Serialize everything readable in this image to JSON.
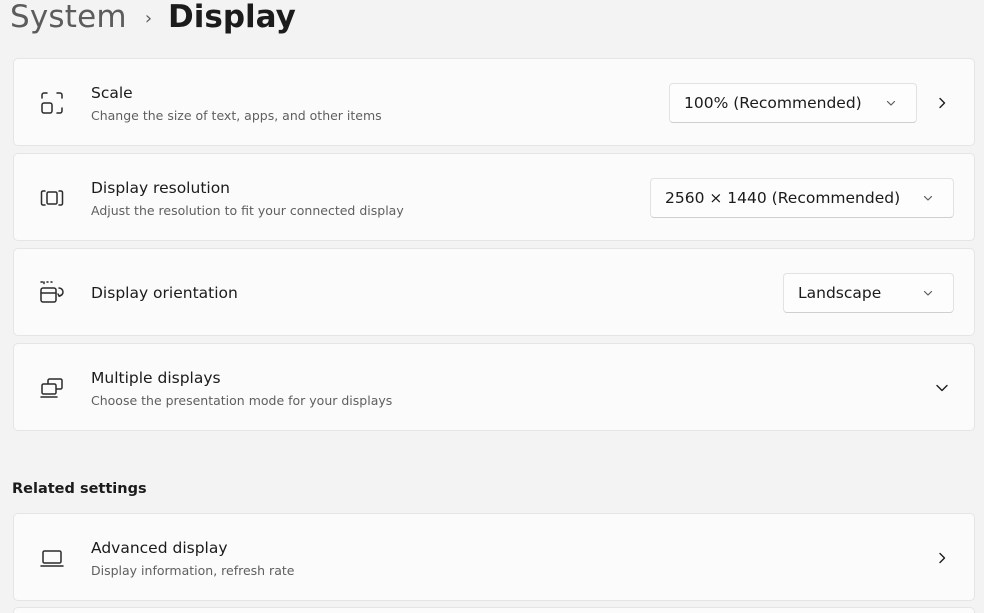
{
  "breadcrumb": {
    "parent": "System",
    "separator": "›",
    "current": "Display"
  },
  "scale": {
    "title": "Scale",
    "subtitle": "Change the size of text, apps, and other items",
    "value": "100% (Recommended)",
    "icon": "scale-icon"
  },
  "resolution": {
    "title": "Display resolution",
    "subtitle": "Adjust the resolution to fit your connected display",
    "value": "2560 × 1440 (Recommended)",
    "icon": "resolution-icon"
  },
  "orientation": {
    "title": "Display orientation",
    "value": "Landscape",
    "icon": "orientation-icon"
  },
  "multiple_displays": {
    "title": "Multiple displays",
    "subtitle": "Choose the presentation mode for your displays",
    "icon": "multiple-displays-icon"
  },
  "related": {
    "heading": "Related settings",
    "advanced": {
      "title": "Advanced display",
      "subtitle": "Display information, refresh rate",
      "icon": "laptop-icon"
    }
  },
  "colors": {
    "background": "#f3f3f3",
    "card": "#fbfbfb",
    "text": "#1b1b1b",
    "subtext": "#5f5f5f"
  }
}
